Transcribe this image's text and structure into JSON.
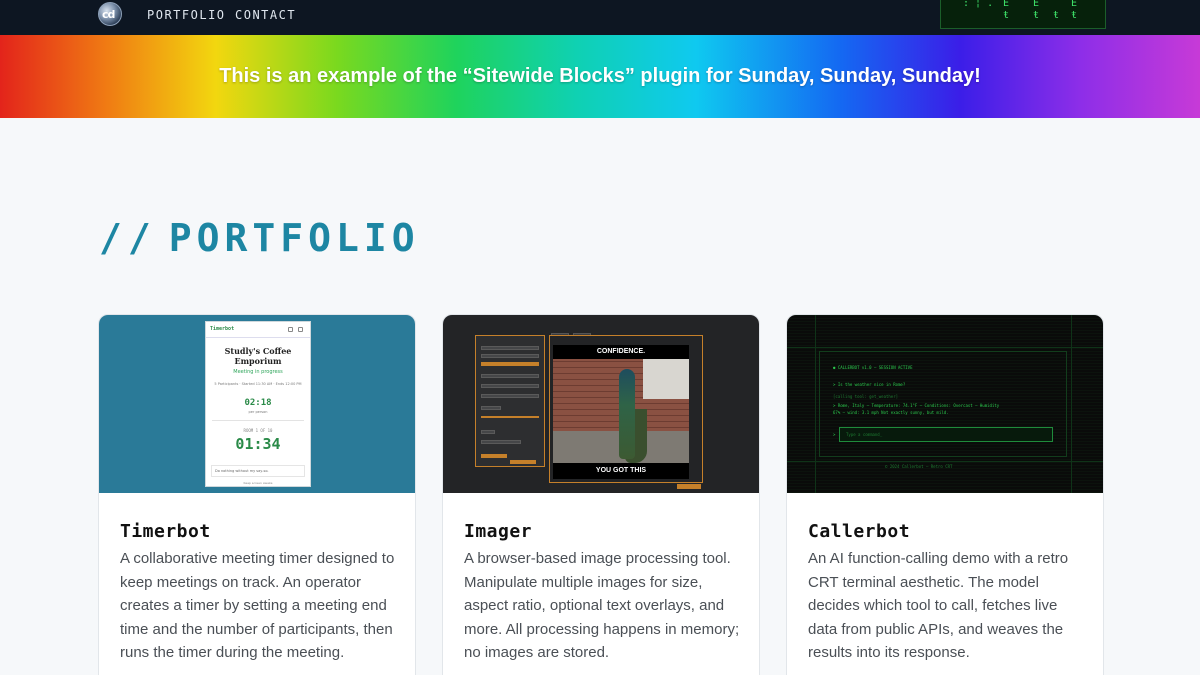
{
  "nav": {
    "logo_text": "cd",
    "links": [
      "PORTFOLIO",
      "CONTACT"
    ]
  },
  "banner": {
    "text": "This is an example of the “Sitewide Blocks” plugin for Sunday, Sunday, Sunday!"
  },
  "section": {
    "slashes": "//",
    "title": "PORTFOLIO"
  },
  "projects": [
    {
      "title": "Timerbot",
      "description": "A collaborative meeting timer designed to keep meetings on track. An operator creates a timer by setting a meeting end time and the number of participants, then runs the timer during the meeting.",
      "thumb": {
        "app_name": "Timerbot",
        "venue": "Studly's Coffee Emporium",
        "status": "Meeting in progress",
        "meta": "5 Participants · Started 11:30 AM · Ends 12:00 PM",
        "small_time": "02:18",
        "small_sub": "per person",
        "room": "ROOM 1 OF 10",
        "big_time": "01:34",
        "note": "Do nothing without my say-so.",
        "footer": "Keep screen awake"
      }
    },
    {
      "title": "Imager",
      "description": "A browser-based image processing tool. Manipulate multiple images for size, aspect ratio, optional text overlays, and more. All processing happens in memory; no images are stored.",
      "thumb": {
        "meme_top": "CONFIDENCE.",
        "meme_bottom": "YOU GOT THIS"
      }
    },
    {
      "title": "Callerbot",
      "description": "An AI function-calling demo with a retro CRT terminal aesthetic. The model decides which tool to call, fetches live data from public APIs, and weaves the results into its response.",
      "thumb": {
        "line1": "● CALLERBOT v1.0 — SESSION ACTIVE",
        "line2": "> Is the weather nice in Rome?",
        "line3": "[calling tool: get_weather]",
        "line4": "> Rome, Italy — Temperature: 74.1°F — Conditions: Overcast — Humidity",
        "line5": "67% — wind: 3.1 mph Not exactly sunny, but mild.",
        "input_placeholder": "Type a command_",
        "footer": "© 2024 Callerbot — Retro CRT"
      }
    }
  ],
  "colors": {
    "nav_bg": "#0d1622",
    "heading": "#1d86a3",
    "timerbot_bg": "#2a7a98",
    "imager_accent": "#c5802a",
    "terminal_green": "#2bc94d"
  }
}
